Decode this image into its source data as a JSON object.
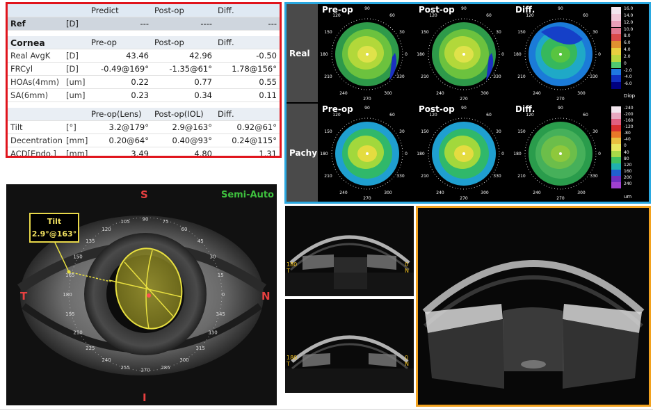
{
  "table": {
    "header": [
      "",
      "",
      "Predict",
      "Post-op",
      "Diff."
    ],
    "ref": {
      "label": "Ref",
      "unit": "[D]",
      "predict": "---",
      "postop": "----",
      "diff": "---"
    },
    "cornea": {
      "title": "Cornea",
      "cols": [
        "Pre-op",
        "Post-op",
        "Diff."
      ],
      "rows": [
        {
          "label": "Real AvgK",
          "unit": "[D]",
          "v1": "43.46",
          "v2": "42.96",
          "v3": "-0.50"
        },
        {
          "label": "FRCyl",
          "unit": "[D]",
          "v1": "-0.49@169°",
          "v2": "-1.35@61°",
          "v3": "1.78@156°"
        },
        {
          "label": "HOAs(4mm)",
          "unit": "[um]",
          "v1": "0.22",
          "v2": "0.77",
          "v3": "0.55"
        },
        {
          "label": "SA(6mm)",
          "unit": "[um]",
          "v1": "0.23",
          "v2": "0.34",
          "v3": "0.11"
        }
      ]
    },
    "lens": {
      "cols": [
        "Pre-op(Lens)",
        "Post-op(IOL)",
        "Diff."
      ],
      "rows": [
        {
          "label": "Tilt",
          "unit": "[°]",
          "v1": "3.2@179°",
          "v2": "2.9@163°",
          "v3": "0.92@61°"
        },
        {
          "label": "Decentration",
          "unit": "[mm]",
          "v1": "0.20@64°",
          "v2": "0.40@93°",
          "v3": "0.24@115°"
        },
        {
          "label": "ACD[Endo.]",
          "unit": "[mm]",
          "v1": "3.49",
          "v2": "4.80",
          "v3": "1.31"
        }
      ]
    }
  },
  "maps": {
    "rows": [
      "Real",
      "Pachy"
    ],
    "titles": [
      "Pre-op",
      "Post-op",
      "Diff."
    ],
    "angles": {
      "top": "90",
      "bottom": "270",
      "left": "180",
      "right": "0",
      "tl": "120",
      "tr": "60",
      "ml": "150",
      "mr": "30",
      "bl": "210",
      "br": "330",
      "bbl": "240",
      "bbr": "300"
    },
    "real_scale": {
      "values": [
        "16.0",
        "14.0",
        "12.0",
        "10.0",
        "8.0",
        "6.0",
        "4.0",
        "2.0",
        "0",
        "-2.0",
        "-4.0",
        "-6.0"
      ],
      "unit": "Diop",
      "colors": [
        "#f2e6ee",
        "#f0c8d8",
        "#e8a0b8",
        "#e07890",
        "#d84a4a",
        "#e09030",
        "#e8d040",
        "#b8d840",
        "#50c870",
        "#1f78e0",
        "#1030c0",
        "#000080"
      ]
    },
    "pachy_scale": {
      "values": [
        "-240",
        "-200",
        "-160",
        "-120",
        "-80",
        "-40",
        "0",
        "40",
        "80",
        "120",
        "160",
        "200",
        "240"
      ],
      "unit": "um",
      "colors": [
        "#f2e6ee",
        "#e8a8c0",
        "#e06080",
        "#d83030",
        "#e87828",
        "#e8c040",
        "#e8e860",
        "#a8d848",
        "#40c060",
        "#20b0b0",
        "#2060d0",
        "#7030c0",
        "#a040d0"
      ]
    }
  },
  "eye": {
    "mode": "Semi-Auto",
    "compass": {
      "s": "S",
      "i": "I",
      "t": "T",
      "n": "N"
    },
    "tilt_title": "Tilt",
    "tilt_value": "2.9°@163°",
    "ring_labels": [
      "90",
      "75",
      "60",
      "45",
      "30",
      "15",
      "0",
      "345",
      "330",
      "315",
      "300",
      "285",
      "270",
      "255",
      "240",
      "225",
      "210",
      "195",
      "180",
      "165",
      "150",
      "135",
      "120",
      "105"
    ]
  },
  "oct": {
    "left_label": "180",
    "left_sub": "T",
    "right_label": "0",
    "right_sub": "N"
  }
}
